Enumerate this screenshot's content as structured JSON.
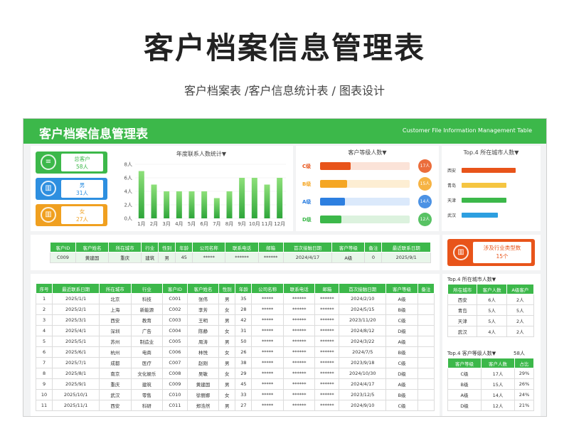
{
  "page": {
    "title": "客户档案信息管理表",
    "subtitle": "客户档案表 /客户信息统计表 / 图表设计"
  },
  "header": {
    "title": "客户档案信息管理表",
    "subtitle_en": "Customer File Information Management Table"
  },
  "kpis": [
    {
      "label": "总客户",
      "value": "58人",
      "icon": "stack-icon",
      "color": "#3cb84a"
    },
    {
      "label": "男",
      "value": "31人",
      "icon": "chart-icon",
      "color": "#2d8fe0"
    },
    {
      "label": "女",
      "value": "27人",
      "icon": "chart-icon",
      "color": "#f0a020"
    }
  ],
  "annual_chart": {
    "title": "年度联系人数统计▼",
    "chart_data": {
      "type": "bar",
      "categories": [
        "1月",
        "2月",
        "3月",
        "4月",
        "5月",
        "6月",
        "7月",
        "8月",
        "9月",
        "10月",
        "11月",
        "12月"
      ],
      "values": [
        7,
        5,
        4,
        4,
        4,
        4,
        3,
        4,
        6,
        6,
        5,
        6
      ],
      "y_ticks": [
        "0人",
        "2人",
        "4人",
        "6人",
        "8人"
      ],
      "ylim": [
        0,
        8
      ]
    }
  },
  "levels": {
    "title": "客户等级人数▼",
    "items": [
      {
        "label": "C级",
        "value": "17人",
        "count": 17,
        "color": "#e8541a",
        "light": "#fbe3d8"
      },
      {
        "label": "B级",
        "value": "15人",
        "count": 15,
        "color": "#f5a623",
        "light": "#fdeed3"
      },
      {
        "label": "A级",
        "value": "14人",
        "count": 14,
        "color": "#2d7fe0",
        "light": "#dbe9fb"
      },
      {
        "label": "D级",
        "value": "12人",
        "count": 12,
        "color": "#3cb84a",
        "light": "#dcf2de"
      }
    ],
    "max": 30
  },
  "cities": {
    "title": "Top.4 所在城市人数▼",
    "items": [
      {
        "label": "西安",
        "count": 6,
        "color": "#e8541a"
      },
      {
        "label": "青岛",
        "count": 5,
        "color": "#f5c542"
      },
      {
        "label": "天津",
        "count": 5,
        "color": "#3cb84a"
      },
      {
        "label": "武汉",
        "count": 4,
        "color": "#2d9fe0"
      }
    ],
    "max": 6
  },
  "search": {
    "headers": [
      "客户ID",
      "客户姓名",
      "所在城市",
      "行业",
      "性别",
      "年龄",
      "公司名称",
      "联系电话",
      "邮箱",
      "首次接触日期",
      "客户等级",
      "备注",
      "最近联系日期"
    ],
    "row": [
      "C009",
      "黄建国",
      "重庆",
      "建筑",
      "男",
      "45",
      "*****",
      "******",
      "******",
      "2024/4/17",
      "A级",
      "0",
      "2025/9/1"
    ]
  },
  "industry_card": {
    "label": "涉及行业类型数",
    "value": "15个"
  },
  "main_table": {
    "headers": [
      "序号",
      "最近联系日期",
      "所在城市",
      "行业",
      "客户ID",
      "客户姓名",
      "性别",
      "年龄",
      "公司名称",
      "联系电话",
      "邮箱",
      "首次接触日期",
      "客户等级",
      "备注"
    ],
    "rows": [
      [
        "1",
        "2025/1/1",
        "北京",
        "科技",
        "C001",
        "张伟",
        "男",
        "35",
        "*****",
        "******",
        "******",
        "2024/2/10",
        "A级",
        ""
      ],
      [
        "2",
        "2025/2/1",
        "上海",
        "新能源",
        "C002",
        "李芳",
        "女",
        "28",
        "*****",
        "******",
        "******",
        "2024/5/15",
        "B级",
        ""
      ],
      [
        "3",
        "2025/3/1",
        "西安",
        "教育",
        "C003",
        "王明",
        "男",
        "42",
        "*****",
        "******",
        "******",
        "2023/11/20",
        "C级",
        ""
      ],
      [
        "4",
        "2025/4/1",
        "深圳",
        "广告",
        "C004",
        "陈静",
        "女",
        "31",
        "*****",
        "******",
        "******",
        "2024/8/12",
        "D级",
        ""
      ],
      [
        "5",
        "2025/5/1",
        "苏州",
        "制造业",
        "C005",
        "周涛",
        "男",
        "50",
        "*****",
        "******",
        "******",
        "2024/3/22",
        "A级",
        ""
      ],
      [
        "6",
        "2025/6/1",
        "杭州",
        "电商",
        "C006",
        "林悦",
        "女",
        "26",
        "*****",
        "******",
        "******",
        "2024/7/5",
        "B级",
        ""
      ],
      [
        "7",
        "2025/7/1",
        "成都",
        "医疗",
        "C007",
        "赵刚",
        "男",
        "38",
        "*****",
        "******",
        "******",
        "2023/9/18",
        "C级",
        ""
      ],
      [
        "8",
        "2025/8/1",
        "南京",
        "文化娱乐",
        "C008",
        "吴敏",
        "女",
        "29",
        "*****",
        "******",
        "******",
        "2024/10/30",
        "D级",
        ""
      ],
      [
        "9",
        "2025/9/1",
        "重庆",
        "建筑",
        "C009",
        "黄建国",
        "男",
        "45",
        "*****",
        "******",
        "******",
        "2024/4/17",
        "A级",
        ""
      ],
      [
        "10",
        "2025/10/1",
        "武汉",
        "零售",
        "C010",
        "徐丽娜",
        "女",
        "33",
        "*****",
        "******",
        "******",
        "2023/12/5",
        "B级",
        ""
      ],
      [
        "11",
        "2025/11/1",
        "西安",
        "科研",
        "C011",
        "郑浩然",
        "男",
        "27",
        "*****",
        "******",
        "******",
        "2024/9/10",
        "C级",
        ""
      ]
    ]
  },
  "city_table": {
    "title": "Top.4 所在城市人数▼",
    "headers": [
      "所在城市",
      "客户人数",
      "A级客户"
    ],
    "rows": [
      [
        "西安",
        "6人",
        "2人"
      ],
      [
        "青岛",
        "5人",
        "5人"
      ],
      [
        "天津",
        "5人",
        "2人"
      ],
      [
        "武汉",
        "4人",
        "2人"
      ]
    ]
  },
  "level_table": {
    "title": "Top.4 客户等级人数▼",
    "total": "58人",
    "headers": [
      "客户等级",
      "客户人数",
      "占比"
    ],
    "rows": [
      [
        "C级",
        "17人",
        "29%"
      ],
      [
        "B级",
        "15人",
        "26%"
      ],
      [
        "A级",
        "14人",
        "24%"
      ],
      [
        "D级",
        "12人",
        "21%"
      ]
    ]
  }
}
